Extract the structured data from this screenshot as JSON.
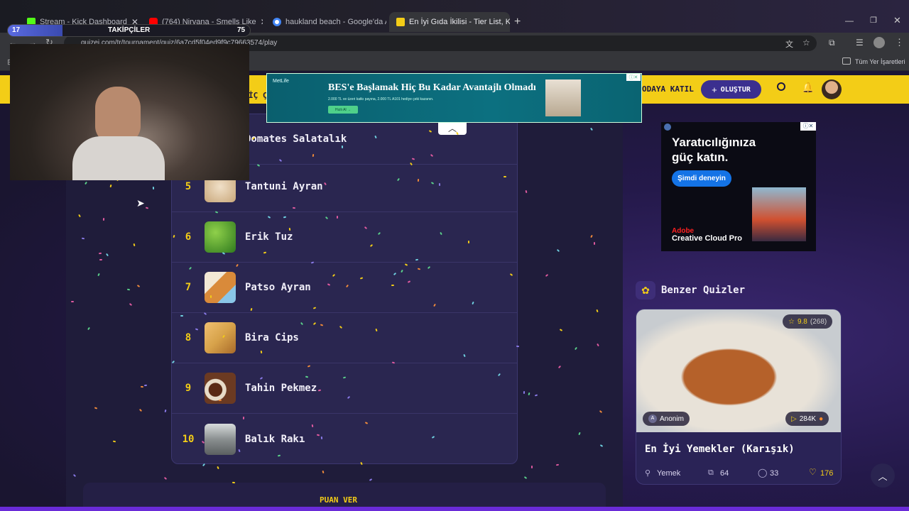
{
  "browser": {
    "tabs": [
      {
        "label": "Stream - Kick Dashboard",
        "favicon_color": "#53fc18"
      },
      {
        "label": "(764) Nirvana - Smells Like",
        "favicon_color": "#ff0000"
      },
      {
        "label": "haukland beach - Google'da Ar",
        "favicon_color": "#4285f4"
      },
      {
        "label": "En İyi Gıda İkilisi - Tier List, Kör",
        "favicon_color": "#f3cd17"
      }
    ],
    "new_tab_symbol": "+",
    "url": "quizei.com/tr/tournament/quiz/6a7cd5f04ed9f9c79663574/play",
    "bookmarks_label": "Tüm Yer İşaretleri"
  },
  "overlay": {
    "followers_current": "17",
    "followers_label": "TAKİPÇİLER",
    "followers_goal": "75",
    "progress_fraction": 0.227
  },
  "site_header": {
    "join_room": "ODAYA KATIL",
    "create_button": "OLUŞTUR",
    "partial_left": "İÇ Ç"
  },
  "ad_top": {
    "brand": "MetLife",
    "headline": "BES'e Başlamak Hiç Bu Kadar Avantajlı Olmadı",
    "subtext": "2.000 TL ve üzeri katkı payına, 2.000 TL A101 hediye çeki kazanın.",
    "cta": "Hızlı Al →"
  },
  "ranking": [
    {
      "rank": "",
      "name": "Domates Salatalık",
      "color": "#c34a36"
    },
    {
      "rank": "5",
      "name": "Tantuni Ayran",
      "color": "#c9a77a"
    },
    {
      "rank": "6",
      "name": "Erik Tuz",
      "color": "#3f9a2a"
    },
    {
      "rank": "7",
      "name": "Patso Ayran",
      "color": "#d98a3a"
    },
    {
      "rank": "8",
      "name": "Bira Cips",
      "color": "#d7a24a"
    },
    {
      "rank": "9",
      "name": "Tahin Pekmez",
      "color": "#6b3a22"
    },
    {
      "rank": "10",
      "name": "Balık Rakı",
      "color": "#8a8f90"
    }
  ],
  "bottom_button_partial": "PUAN VER",
  "ad_side": {
    "headline": "Yaratıcılığınıza güç katın.",
    "cta": "Şimdi deneyin",
    "brand_top": "Adobe",
    "brand": "Creative Cloud Pro"
  },
  "similar": {
    "heading": "Benzer Quizler",
    "card": {
      "rating": "9.8",
      "rating_count": "(268)",
      "author": "Anonim",
      "plays": "284K",
      "title": "En İyi Yemekler (Karışık)",
      "category": "Yemek",
      "items": "64",
      "comments": "33",
      "likes": "176"
    }
  },
  "colors": {
    "accent": "#f3cd17",
    "panel": "#2a2650",
    "primary_button": "#3b2f8f"
  }
}
